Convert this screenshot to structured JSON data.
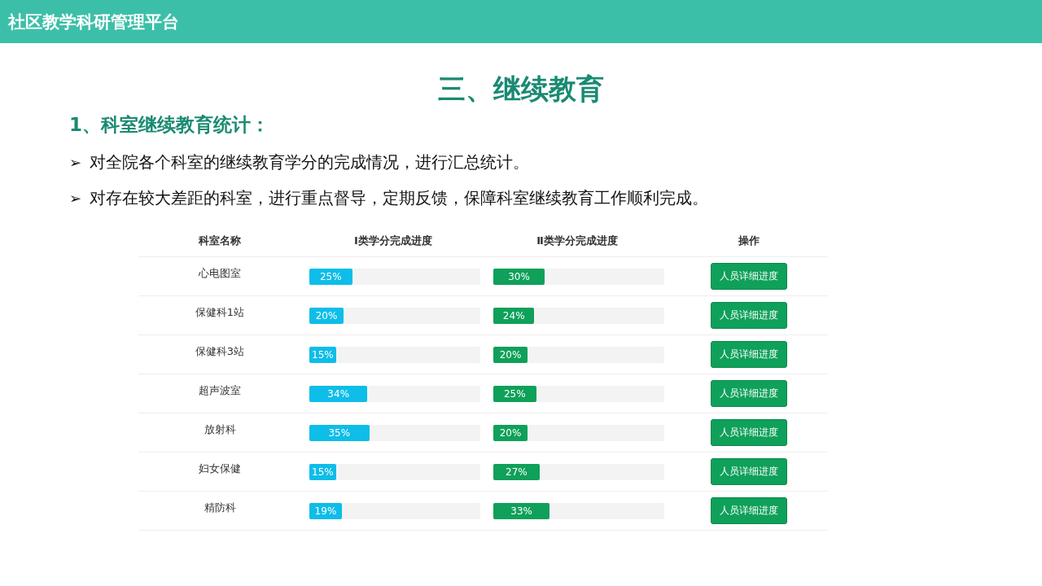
{
  "header": {
    "title": "社区教学科研管理平台"
  },
  "heading": "三、继续教育",
  "subheading": "1、科室继续教育统计：",
  "bullets": [
    "对全院各个科室的继续教育学分的完成情况，进行汇总统计。",
    "对存在较大差距的科室，进行重点督导，定期反馈，保障科室继续教育工作顺利完成。"
  ],
  "bullet_marker": "➢",
  "table": {
    "columns": [
      "科室名称",
      "Ⅰ类学分完成进度",
      "Ⅱ类学分完成进度",
      "操作"
    ],
    "rows": [
      {
        "name": "心电图室",
        "class1": {
          "level": 0.25,
          "label": "25%"
        },
        "class2": {
          "level": 0.3,
          "label": "30%"
        },
        "action": "人员详细进度"
      },
      {
        "name": "保健科1站",
        "class1": {
          "level": 0.2,
          "label": "20%"
        },
        "class2": {
          "level": 0.24,
          "label": "24%"
        },
        "action": "人员详细进度"
      },
      {
        "name": "保健科3站",
        "class1": {
          "level": 0.15,
          "label": "15%"
        },
        "class2": {
          "level": 0.2,
          "label": "20%"
        },
        "action": "人员详细进度"
      },
      {
        "name": "超声波室",
        "class1": {
          "level": 0.34,
          "label": "34%"
        },
        "class2": {
          "level": 0.25,
          "label": "25%"
        },
        "action": "人员详细进度"
      },
      {
        "name": "放射科",
        "class1": {
          "level": 0.35,
          "label": "35%"
        },
        "class2": {
          "level": 0.2,
          "label": "20%"
        },
        "action": "人员详细进度"
      },
      {
        "name": "妇女保健",
        "class1": {
          "level": 0.15,
          "label": "15%"
        },
        "class2": {
          "level": 0.27,
          "label": "27%"
        },
        "action": "人员详细进度"
      },
      {
        "name": "精防科",
        "class1": {
          "level": 0.19,
          "label": "19%"
        },
        "class2": {
          "level": 0.33,
          "label": "33%"
        },
        "action": "人员详细进度"
      }
    ]
  }
}
